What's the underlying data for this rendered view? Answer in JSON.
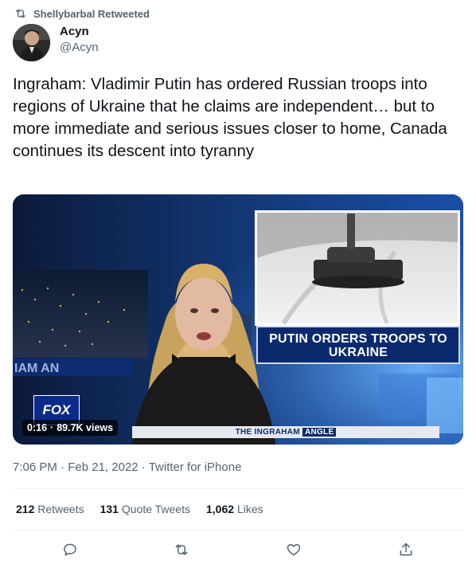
{
  "retweet_context": {
    "text": "Shellybarbal Retweeted"
  },
  "author": {
    "name": "Acyn",
    "handle": "@Acyn"
  },
  "tweet": {
    "text": "Ingraham: Vladimir Putin has ordered Russian troops into regions of Ukraine that he claims are independent… but to more immediate and serious issues closer to home, Canada continues its descent into tyranny"
  },
  "media": {
    "headline": "PUTIN ORDERS TROOPS TO UKRAINE",
    "show_name": "THE INGRAHAM",
    "show_name_suffix": "ANGLE",
    "fox_logo": "FOX",
    "left_banner": "IAM AN",
    "duration": "0:16",
    "separator": "·",
    "views": "89.7K views"
  },
  "meta": {
    "time": "7:06 PM",
    "date": "Feb 21, 2022",
    "source": "Twitter for iPhone",
    "sep": "·"
  },
  "stats": {
    "retweets": {
      "num": "212",
      "label": "Retweets"
    },
    "quotes": {
      "num": "131",
      "label": "Quote Tweets"
    },
    "likes": {
      "num": "1,062",
      "label": "Likes"
    }
  },
  "icons": [
    "retweet-icon",
    "reply-icon",
    "like-icon",
    "share-icon"
  ],
  "colors": {
    "text": "#0f1419",
    "muted": "#536471",
    "divider": "#eff3f4",
    "fox_blue": "#0b2a6e"
  }
}
